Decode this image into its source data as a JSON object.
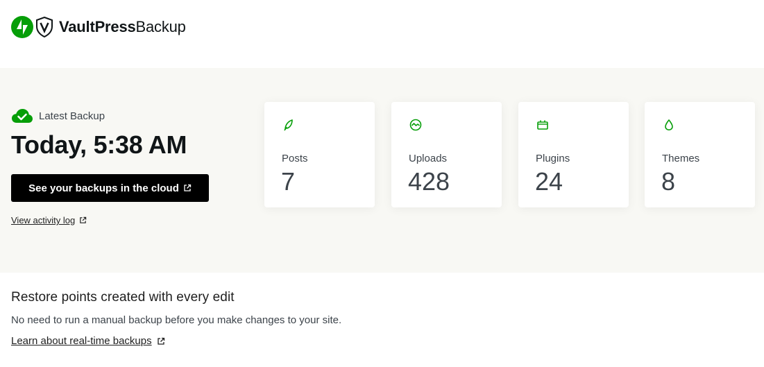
{
  "header": {
    "brand_bold": "VaultPress",
    "brand_light": "Backup"
  },
  "latest_backup": {
    "label": "Latest Backup",
    "time": "Today, 5:38 AM",
    "cloud_button_label": "See your backups in the cloud",
    "activity_link_label": "View activity log"
  },
  "stats": [
    {
      "label": "Posts",
      "value": "7",
      "icon": "leaf-icon"
    },
    {
      "label": "Uploads",
      "value": "428",
      "icon": "image-icon"
    },
    {
      "label": "Plugins",
      "value": "24",
      "icon": "plugin-icon"
    },
    {
      "label": "Themes",
      "value": "8",
      "icon": "drop-icon"
    }
  ],
  "info": {
    "title": "Restore points created with every edit",
    "description": "No need to run a manual backup before you make changes to your site.",
    "link_label": "Learn about real-time backups"
  },
  "colors": {
    "accent_green": "#069e08",
    "button_bg": "#000000",
    "hero_bg": "#f8f8f4"
  }
}
